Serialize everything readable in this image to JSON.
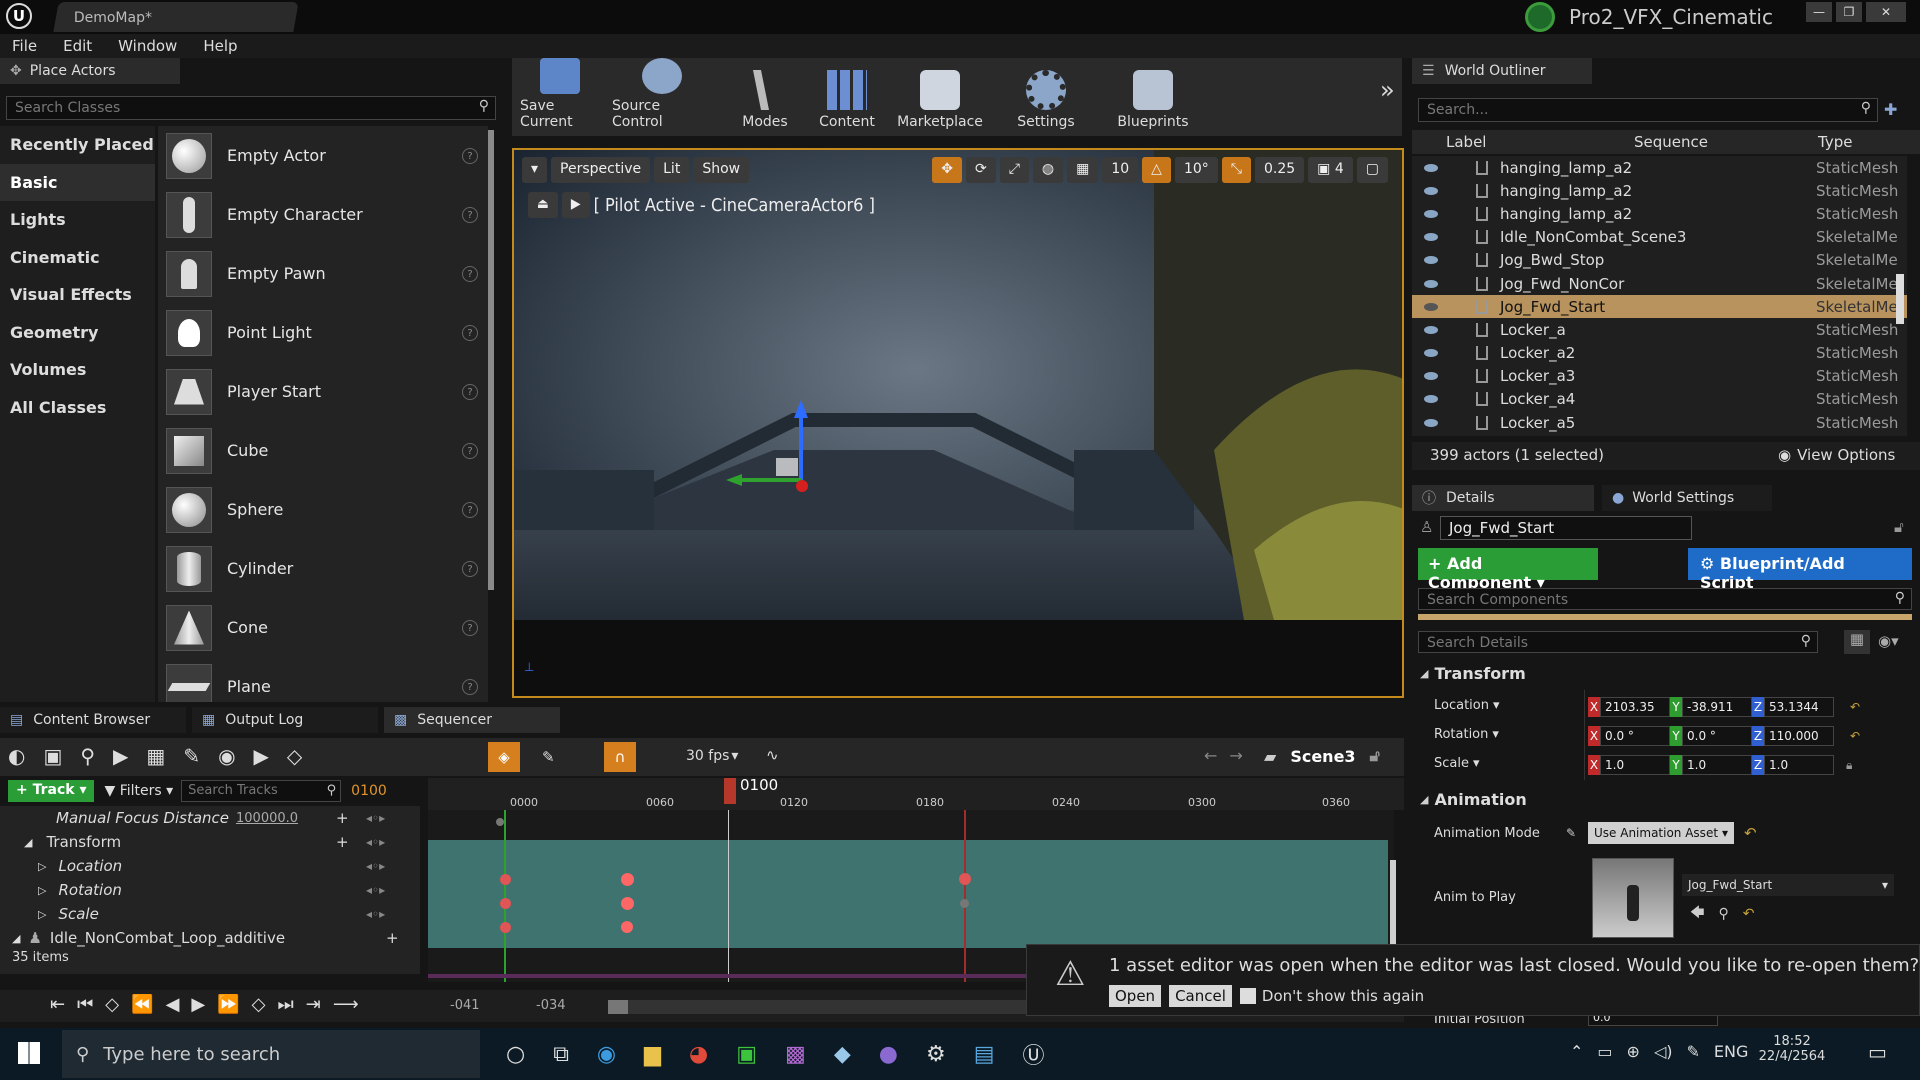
{
  "window": {
    "doc_tab": "DemoMap*",
    "project": "Pro2_VFX_Cinematic"
  },
  "menu": [
    "File",
    "Edit",
    "Window",
    "Help"
  ],
  "place_actors": {
    "tab": "Place Actors",
    "search_placeholder": "Search Classes",
    "categories": [
      "Recently Placed",
      "Basic",
      "Lights",
      "Cinematic",
      "Visual Effects",
      "Geometry",
      "Volumes",
      "All Classes"
    ],
    "selected_category": "Basic",
    "actors": [
      "Empty Actor",
      "Empty Character",
      "Empty Pawn",
      "Point Light",
      "Player Start",
      "Cube",
      "Sphere",
      "Cylinder",
      "Cone",
      "Plane"
    ]
  },
  "toolbar": {
    "buttons": [
      "Save Current",
      "Source Control",
      "Modes",
      "Content",
      "Marketplace",
      "Settings",
      "Blueprints"
    ]
  },
  "viewport": {
    "perspective": "Perspective",
    "lit": "Lit",
    "show": "Show",
    "grid_snap": "10",
    "rot_snap": "10°",
    "scale_snap": "0.25",
    "cam_speed": "4",
    "pilot_label": "[ Pilot Active - CineCameraActor6 ]"
  },
  "outliner": {
    "tab": "World Outliner",
    "search_placeholder": "Search...",
    "col_label": "Label",
    "col_sequence": "Sequence",
    "col_type": "Type",
    "rows": [
      {
        "label": "hanging_lamp_a2",
        "type": "StaticMesh"
      },
      {
        "label": "hanging_lamp_a2",
        "type": "StaticMesh"
      },
      {
        "label": "hanging_lamp_a2",
        "type": "StaticMesh"
      },
      {
        "label": "Idle_NonCombat_Scene3",
        "type": "SkeletalMe"
      },
      {
        "label": "Jog_Bwd_Stop",
        "type": "SkeletalMe"
      },
      {
        "label": "Jog_Fwd_NonCor",
        "type": "SkeletalMe"
      },
      {
        "label": "Jog_Fwd_Start",
        "type": "SkeletalMe",
        "selected": true
      },
      {
        "label": "Locker_a",
        "type": "StaticMesh"
      },
      {
        "label": "Locker_a2",
        "type": "StaticMesh"
      },
      {
        "label": "Locker_a3",
        "type": "StaticMesh"
      },
      {
        "label": "Locker_a4",
        "type": "StaticMesh"
      },
      {
        "label": "Locker_a5",
        "type": "StaticMesh"
      }
    ],
    "count": "399 actors (1 selected)",
    "view_options": "View Options"
  },
  "details": {
    "tab": "Details",
    "tab2": "World Settings",
    "name": "Jog_Fwd_Start",
    "add_component": "+ Add Component",
    "blueprint": "Blueprint/Add Script",
    "search_components": "Search Components",
    "search_details": "Search Details",
    "transform": "Transform",
    "location": {
      "label": "Location",
      "x": "2103.35",
      "y": "-38.911",
      "z": "53.1344"
    },
    "rotation": {
      "label": "Rotation",
      "x": "0.0 °",
      "y": "0.0 °",
      "z": "110.000"
    },
    "scale": {
      "label": "Scale",
      "x": "1.0",
      "y": "1.0",
      "z": "1.0"
    },
    "animation": "Animation",
    "anim_mode_label": "Animation Mode",
    "anim_mode": "Use Animation Asset",
    "anim_to_play_label": "Anim to Play",
    "anim_to_play": "Jog_Fwd_Start",
    "initial_position_label": "Initial Position",
    "initial_position": "0.0"
  },
  "bottom_tabs": [
    "Content Browser",
    "Output Log",
    "Sequencer"
  ],
  "sequencer": {
    "fps": "30 fps",
    "scene": "Scene3",
    "track_btn": "+ Track",
    "filters": "Filters",
    "search_tracks": "Search Tracks",
    "current_frame": "0100",
    "playhead": "0100",
    "ruler": [
      "0000",
      "0060",
      "0120",
      "0180",
      "0240",
      "0300",
      "0360"
    ],
    "tracks": [
      {
        "name": "Manual Focus Distance",
        "value": "100000.0"
      },
      {
        "name": "Transform"
      },
      {
        "name": "Location"
      },
      {
        "name": "Rotation"
      },
      {
        "name": "Scale"
      },
      {
        "name": "Idle_NonCombat_Loop_additive"
      }
    ],
    "items": "35 items",
    "range_start": "-041",
    "range_start2": "-034"
  },
  "notification": {
    "message": "1 asset editor was open when the editor was last closed. Would you like to re-open them?",
    "open": "Open",
    "cancel": "Cancel",
    "dont_show": "Don't show this again"
  },
  "taskbar": {
    "search": "Type here to search",
    "lang": "ENG",
    "time": "18:52",
    "date": "22/4/2564"
  }
}
